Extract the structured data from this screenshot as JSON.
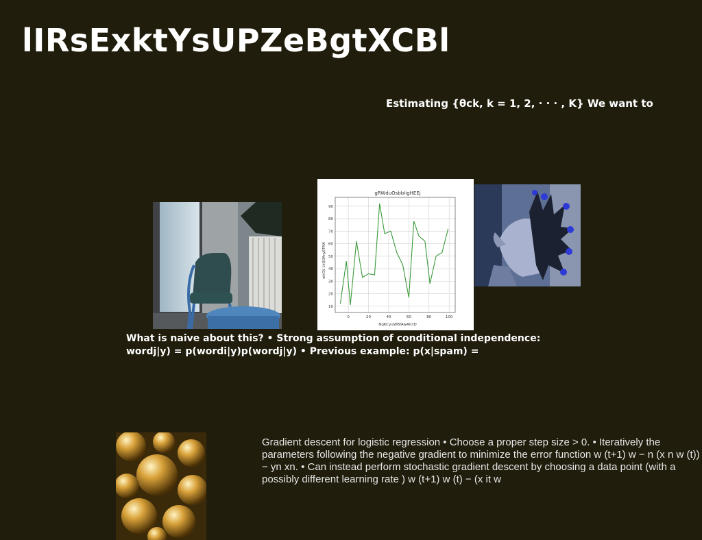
{
  "slide": {
    "title": "lIRsExktYsUPZeBgtXCBl",
    "subtitle": "Estimating {θck, k = 1, 2, · · · , K} We want to",
    "middle_text": "What is naive about this? • Strong assumption of conditional independence: wordj|y) = p(wordi|y)p(wordj|y) • Previous example: p(x|spam) =",
    "bottom_text": "Gradient descent for logistic regression • Choose a proper step size  > 0. • Iteratively the parameters following the negative gradient to minimize the error function w (t+1)  w −   n  (x n w (t)) − yn  xn. • Can instead perform stochastic gradient descent by choosing a data point (with a possibly different learning rate ) w (t+1)  w (t) −   (x it w"
  },
  "chart_data": {
    "type": "line",
    "title": "gRWduOsbbIigHEEj",
    "xlabel": "NqKCyuWBfAwAlctD",
    "ylabel": "wlrGV LhQOAnyETMA",
    "x": [
      -8,
      -2,
      2,
      8,
      14,
      20,
      26,
      31,
      36,
      42,
      48,
      54,
      60,
      65,
      70,
      76,
      81,
      87,
      93,
      99
    ],
    "series": [
      {
        "values": [
          12,
          46,
          11,
          62,
          33,
          36,
          35,
          92,
          68,
          70,
          53,
          43,
          17,
          78,
          66,
          62,
          28,
          50,
          53,
          72
        ],
        "color": "#3a9a3a"
      }
    ],
    "xlim": [
      -13,
      106
    ],
    "ylim": [
      5,
      97
    ],
    "xticks": [
      0,
      20,
      40,
      60,
      80,
      100
    ],
    "yticks": [
      10,
      20,
      30,
      40,
      50,
      60,
      70,
      80,
      90
    ],
    "grid": true
  }
}
